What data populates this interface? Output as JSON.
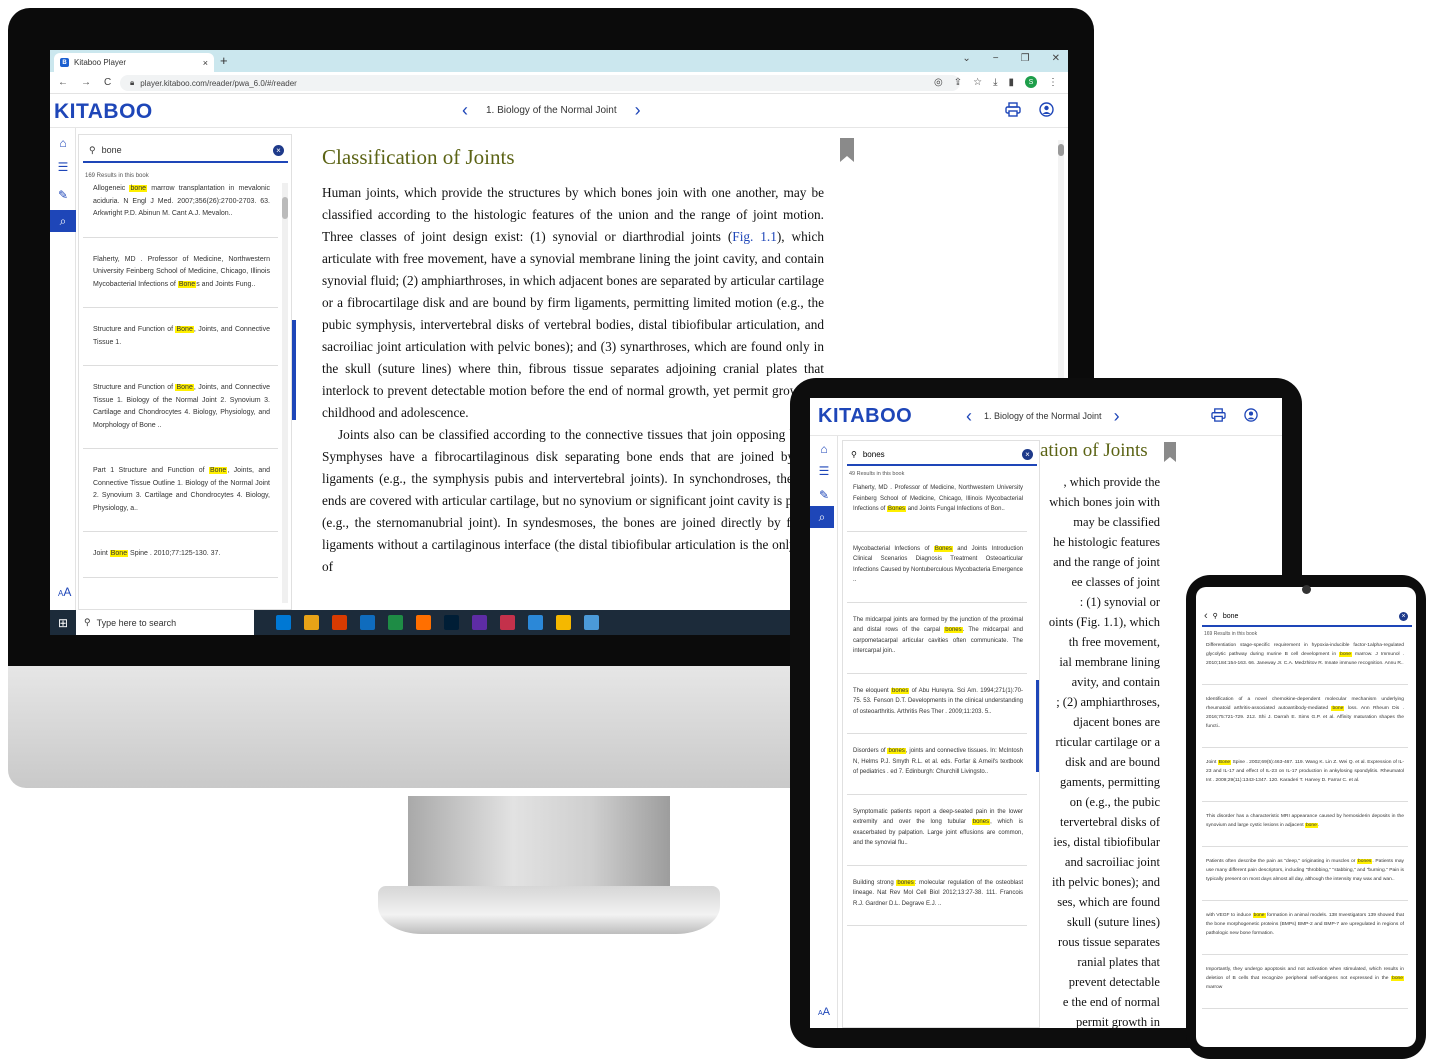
{
  "browser": {
    "tab_title": "Kitaboo Player",
    "tab_close": "×",
    "new_tab": "+",
    "url": "player.kitaboo.com/reader/pwa_6.0/#/reader",
    "back": "←",
    "forward": "→",
    "reload": "C",
    "win_controls": [
      "⌄",
      "−",
      "❐",
      "✕"
    ],
    "profile_initial": "S"
  },
  "app": {
    "logo": "KITABOO",
    "chapter": "1. Biology of the Normal Joint",
    "prev": "‹",
    "next": "›",
    "print_icon": "printer-icon",
    "profile_icon": "user-profile-icon",
    "font_size_label": "A"
  },
  "search": {
    "query": "bone",
    "result_count": "169 Results in this book",
    "results": [
      {
        "pre": "Allogeneic ",
        "hit": "bone",
        "post": " marrow transplantation in mevalonic aciduria. N Engl J Med. 2007;356(26):2700-2703. 63. Arkwright P.D. Abinun M. Cant A.J. Mevalon.."
      },
      {
        "pre": "Flaherty, MD . Professor of Medicine, Northwestern University Feinberg School of Medicine, Chicago, Illinois Mycobacterial Infections of ",
        "hit": "Bone",
        "post": "s and Joints Fung.."
      },
      {
        "pre": "Structure and Function of ",
        "hit": "Bone",
        "post": ", Joints, and Connective Tissue 1."
      },
      {
        "pre": "Structure and Function of ",
        "hit": "Bone",
        "post": ", Joints, and Connective Tissue 1. Biology of the Normal Joint 2. Synovium 3. Cartilage and Chondrocytes 4. Biology, Physiology, and Morphology of Bone .."
      },
      {
        "pre": "Part 1 Structure and Function of ",
        "hit": "Bone",
        "post": ", Joints, and Connective Tissue Outline 1. Biology of the Normal Joint 2. Synovium 3. Cartilage and Chondrocytes 4. Biology, Physiology, a.."
      },
      {
        "pre": "Joint ",
        "hit": "Bone",
        "post": " Spine . 2010;77:125-130. 37."
      }
    ]
  },
  "reader": {
    "title": "Classification of Joints",
    "p1_a": "Human joints, which provide the structures by which bones join with one another, may be classified according to the histologic features of the union and the range of joint motion. Three classes of joint design exist: (1) synovial or diarthrodial joints (",
    "fig": "Fig. 1.1",
    "p1_b": "), which articulate with free movement, have a synovial membrane lining the joint cavity, and contain synovial fluid; (2) amphiarthroses, in which adjacent bones are separated by articular cartilage or a fibrocartilage disk and are bound by firm ligaments, permitting limited motion (e.g., the pubic symphysis, intervertebral disks of vertebral bodies, distal tibiofibular articulation, and sacroiliac joint articulation with pelvic bones); and (3) synarthroses, which are found only in the skull (suture lines) where thin, fibrous tissue separates adjoining cranial plates that interlock to prevent detectable motion before the end of normal growth, yet permit growth in childhood and adolescence.",
    "p2": "Joints also can be classified according to the connective tissues that join opposing bones. Symphyses have a fibrocartilaginous disk separating bone ends that are joined by firm ligaments (e.g., the symphysis pubis and intervertebral joints). In synchondroses, the bone ends are covered with articular cartilage, but no synovium or significant joint cavity is present (e.g., the sternomanubrial joint). In syndesmoses, the bones are joined directly by fibrous ligaments without a cartilaginous interface (the distal tibiofibular articulation is the only joint of"
  },
  "taskbar": {
    "start": "⊞",
    "search_placeholder": "Type here to search",
    "app_colors": [
      "#0078d4",
      "#e8a317",
      "#d83b01",
      "#0f6cbd",
      "#1e8c45",
      "#ff6f00",
      "#001e36",
      "#5e2ca5",
      "#c4314b",
      "#2b88d8",
      "#f5b800",
      "#4b9ad8"
    ]
  },
  "tablet": {
    "logo": "KITABOO",
    "chapter": "1. Biology of the Normal Joint",
    "query": "bones",
    "result_count": "49 Results in this book",
    "results": [
      {
        "pre": "Flaherty, MD . Professor of Medicine, Northwestern University Feinberg School of Medicine, Chicago, Illinois Mycobacterial Infections of ",
        "hit": "Bones",
        "post": " and Joints Fungal Infections of Bon.."
      },
      {
        "pre": "Mycobacterial Infections of ",
        "hit": "Bones",
        "post": " and Joints Introduction Clinical Scenarios Diagnosis Treatment Osteoarticular Infections Caused by Nontuberculous Mycobacteria Emergence .."
      },
      {
        "pre": "The midcarpal joints are formed by the junction of the proximal and distal rows of the carpal ",
        "hit": "bones",
        "post": ". The midcarpal and carpometacarpal articular cavities often communicate. The intercarpal join.."
      },
      {
        "pre": "The eloquent ",
        "hit": "bones",
        "post": " of Abu Hureyra. Sci Am. 1994;271(1):70-75. 53. Fenson D.T. Developments in the clinical understanding of osteoarthritis. Arthritis Res Ther . 2009;11:203. 5.."
      },
      {
        "pre": "Disorders of ",
        "hit": "bones",
        "post": ", joints and connective tissues. In: McIntosh N, Helms P.J. Smyth R.L. et al. eds. Forfar & Arneil's textbook of pediatrics . ed 7. Edinburgh: Churchill Livingsto.."
      },
      {
        "pre": "Symptomatic patients report a deep-seated pain in the lower extremity and over the long tubular ",
        "hit": "bones",
        "post": ", which is exacerbated by palpation. Large joint effusions are common, and the synovial flu.."
      },
      {
        "pre": "Building strong ",
        "hit": "bones",
        "post": ": molecular regulation of the osteoblast lineage. Nat Rev Mol Cell Biol 2012;13:27-38. 111. Francois R.J. Gardner D.L. Degrave E.J. .."
      }
    ],
    "reader_title": "ation of Joints",
    "lines": [
      ", which provide the",
      "which bones join with",
      "may be classified",
      "he histologic features",
      "and the range of joint",
      "ee classes of joint",
      ": (1) synovial or",
      "oints (Fig. 1.1), which",
      "th free movement,",
      "ial membrane lining",
      "avity, and contain",
      "; (2) amphiarthroses,",
      "djacent bones are",
      "rticular cartilage or a",
      "disk and are bound",
      "gaments, permitting",
      "on (e.g., the pubic",
      "tervertebral disks of",
      "ies, distal tibiofibular",
      "and sacroiliac joint",
      "ith pelvic bones); and",
      "ses, which are found",
      "skull (suture lines)",
      "rous tissue separates",
      "ranial plates that",
      "prevent detectable",
      "e the end of normal",
      "permit growth in"
    ]
  },
  "phone": {
    "query": "bone",
    "result_count": "169 Results in this book",
    "results": [
      {
        "pre": "Differentiation stage-specific requirement in hypoxia-inducible factor-1alpha-regulated glycolytic pathway during murine B cell development in ",
        "hit": "bone",
        "post": " marrow. J Immunol . 2010;184:154-163. 66. Janeway Jr. C.A. Medzhitov R. Innate immune recognition. Annu R.."
      },
      {
        "pre": "Identification of a novel chemokine-dependent molecular mechanism underlying rheumatoid arthritis-associated autoantibody-mediated ",
        "hit": "bone",
        "post": " loss. Ann Rheum Dis . 2016;75:721-729. 212. Shi J. Darrah E. Sims G.P. et al. Affinity maturation shapes the functi.."
      },
      {
        "pre": "Joint ",
        "hit": "Bone",
        "post": " Spine . 2002;69(5):463-467. 119. Wang K. Lin Z. Wei Q. et al. Expression of IL-23 and IL-17 and effect of IL-23 on IL-17 production in ankylosing spondylitis. Rheumatol Int . 2009;29(11):1343-1347. 120. Karaderi T. Harvey D. Farrar C. et al."
      },
      {
        "pre": "This disorder has a characteristic MRI appearance caused by hemosiderin deposits in the synovium and large cystic lesions in adjacent ",
        "hit": "bone",
        "post": "."
      },
      {
        "pre": "Patients often describe the pain as \"deep,\" originating in muscles or ",
        "hit": "bones",
        "post": ". Patients may use many different pain descriptors, including \"throbbing,\" \"stabbing,\" and \"burning.\" Pain is typically present on most days almost all day, although the intensity may wax and wan.."
      },
      {
        "pre": "with VEGF to induce ",
        "hit": "bone",
        "post": " formation in animal models. 138 Investigators 139 showed that the bone morphogenetic proteins (BMPs) BMP-2 and BMP-7 are upregulated in regions of pathologic new bone formation."
      },
      {
        "pre": "Importantly, they undergo apoptosis and not activation when stimulated, which results in deletion of B cells that recognize peripheral self-antigens not expressed in the ",
        "hit": "bone",
        "post": " marrow"
      }
    ]
  }
}
